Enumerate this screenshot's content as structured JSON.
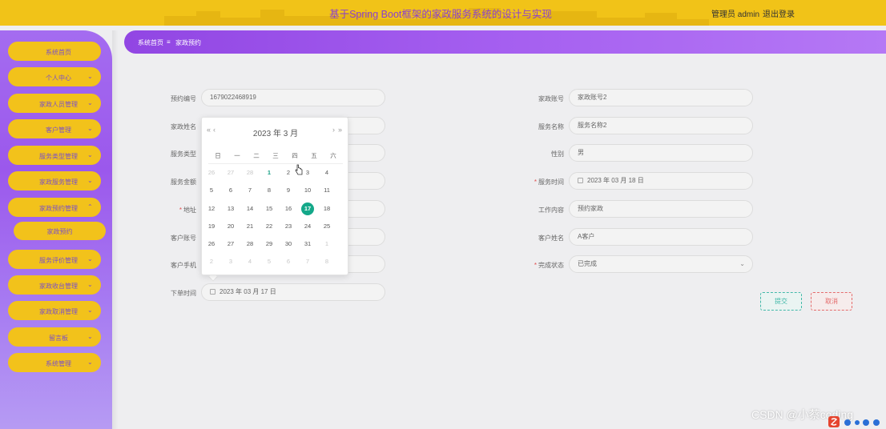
{
  "header": {
    "title": "基于Spring Boot框架的家政服务系统的设计与实现",
    "user_role": "管理员 admin",
    "logout": "退出登录"
  },
  "sidebar": {
    "items": [
      {
        "label": "系统首页",
        "expandable": false
      },
      {
        "label": "个人中心",
        "expandable": true
      },
      {
        "label": "家政人员管理",
        "expandable": true
      },
      {
        "label": "客户管理",
        "expandable": true
      },
      {
        "label": "服务类型管理",
        "expandable": true
      },
      {
        "label": "家政服务管理",
        "expandable": true
      },
      {
        "label": "家政预约管理",
        "expandable": true,
        "expanded": true
      },
      {
        "label": "服务评价管理",
        "expandable": true
      },
      {
        "label": "家政收台管理",
        "expandable": true
      },
      {
        "label": "家政取消管理",
        "expandable": true
      },
      {
        "label": "留言板",
        "expandable": true
      },
      {
        "label": "系统管理",
        "expandable": true
      }
    ],
    "sub_item": "家政预约"
  },
  "breadcrumb": {
    "home": "系统首页",
    "separator": "≡",
    "current": "家政预约"
  },
  "form": {
    "left": [
      {
        "label": "预约编号",
        "value": "1679022468919",
        "required": false
      },
      {
        "label": "家政姓名",
        "value": "",
        "required": false
      },
      {
        "label": "服务类型",
        "value": "",
        "required": false
      },
      {
        "label": "服务金额",
        "value": "",
        "required": false
      },
      {
        "label": "地址",
        "value": "",
        "required": true
      },
      {
        "label": "客户账号",
        "value": "",
        "required": false
      },
      {
        "label": "客户手机",
        "value": "",
        "required": false
      },
      {
        "label": "下单时间",
        "value": "2023 年 03 月 17 日",
        "required": false
      }
    ],
    "right": [
      {
        "label": "家政账号",
        "value": "家政账号2",
        "required": false
      },
      {
        "label": "服务名称",
        "value": "服务名称2",
        "required": false
      },
      {
        "label": "性别",
        "value": "男",
        "required": false
      },
      {
        "label": "服务时间",
        "value": "2023 年 03 月 18 日",
        "required": true
      },
      {
        "label": "工作内容",
        "value": "预约家政",
        "required": false
      },
      {
        "label": "客户姓名",
        "value": "A客户",
        "required": false
      },
      {
        "label": "完成状态",
        "value": "已完成",
        "required": true
      }
    ],
    "submit_label": "提交",
    "cancel_label": "取消"
  },
  "datepicker": {
    "title": "2023 年  3 月",
    "prev_year": "«",
    "prev_month": "‹",
    "next_month": "›",
    "next_year": "»",
    "weekdays": [
      "日",
      "一",
      "二",
      "三",
      "四",
      "五",
      "六"
    ],
    "weeks": [
      [
        "26",
        "27",
        "28",
        "1",
        "2",
        "3",
        "4"
      ],
      [
        "5",
        "6",
        "7",
        "8",
        "9",
        "10",
        "11"
      ],
      [
        "12",
        "13",
        "14",
        "15",
        "16",
        "17",
        "18"
      ],
      [
        "19",
        "20",
        "21",
        "22",
        "23",
        "24",
        "25"
      ],
      [
        "26",
        "27",
        "28",
        "29",
        "30",
        "31",
        "1"
      ],
      [
        "2",
        "3",
        "4",
        "5",
        "6",
        "7",
        "8"
      ]
    ],
    "selected_day": "17"
  },
  "watermark": "CSDN @小蔡coding",
  "colors": {
    "header_bg": "#f1c318",
    "accent_purple": "#9b58ec",
    "menu_yellow": "#f2c21b",
    "selected_green": "#14a889",
    "cancel_red": "#e46c6c"
  }
}
